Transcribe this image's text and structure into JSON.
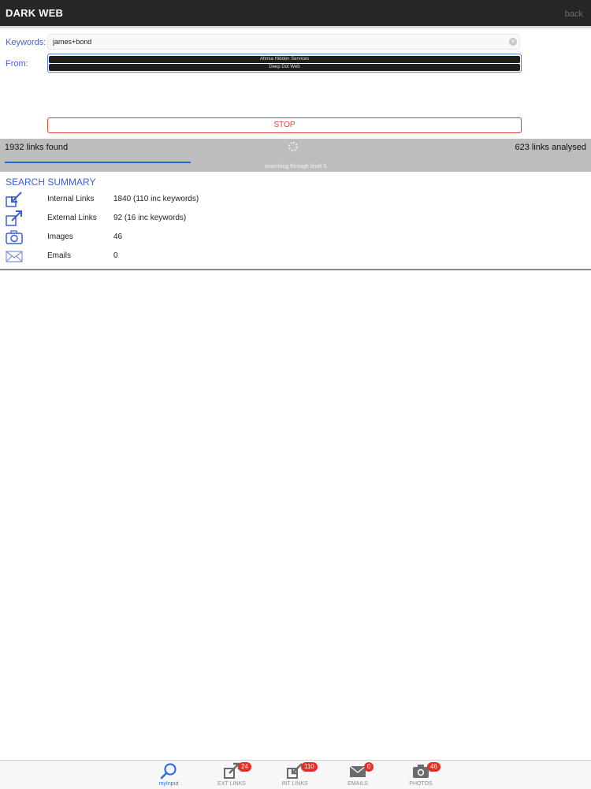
{
  "navbar": {
    "title": "DARK WEB",
    "back_label": "back"
  },
  "search": {
    "keywords_label": "Keywords:",
    "keywords_value": "james+bond",
    "from_label": "From:",
    "sources": [
      "Ahmia Hidden Services",
      "Deep Dot Web"
    ]
  },
  "stop_label": "STOP",
  "status": {
    "links_found": "1932 links found",
    "links_analysed": "623 links analysed",
    "subtext": "searching through level 3",
    "progress_fraction": 0.32
  },
  "summary": {
    "title": "SEARCH SUMMARY",
    "rows": [
      {
        "label": "Internal Links",
        "value": "1840 (110 inc keywords)",
        "icon": "internal-link-icon"
      },
      {
        "label": "External Links",
        "value": "92 (16 inc keywords)",
        "icon": "external-link-icon"
      },
      {
        "label": "Images",
        "value": "46",
        "icon": "camera-icon"
      },
      {
        "label": "Emails",
        "value": "0",
        "icon": "envelope-icon"
      }
    ]
  },
  "tabs": [
    {
      "label": "myInput",
      "badge": null,
      "icon": "magnifier-icon",
      "active": true
    },
    {
      "label": "EXT LINKS",
      "badge": "24",
      "icon": "external-link-icon",
      "active": false
    },
    {
      "label": "INT LINKS",
      "badge": "110",
      "icon": "internal-link-icon",
      "active": false
    },
    {
      "label": "EMAILS",
      "badge": "0",
      "icon": "envelope-icon",
      "active": false
    },
    {
      "label": "PHOTOS",
      "badge": "46",
      "icon": "camera-icon",
      "active": false
    }
  ],
  "colors": {
    "navbar": "#262626",
    "accent_blue": "#3a5fd0",
    "stop_red": "#e0423a",
    "status_bar": "#bdbdbd",
    "badge_red": "#e0312a"
  }
}
